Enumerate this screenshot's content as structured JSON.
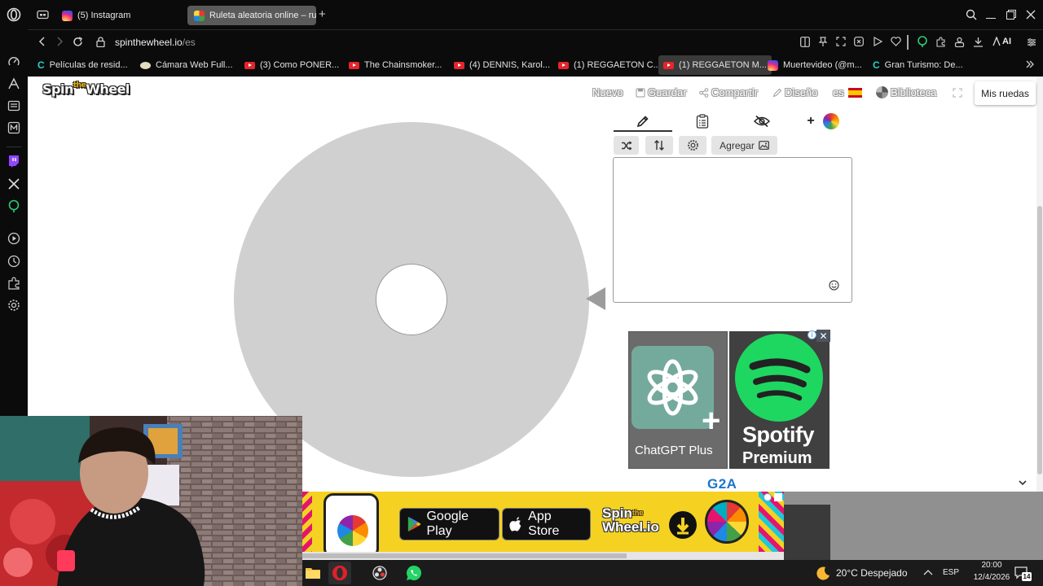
{
  "browser": {
    "tabs": [
      {
        "label": "(5) Instagram",
        "active": false
      },
      {
        "label": "Ruleta aleatoria online – ru",
        "active": true
      }
    ],
    "new_tab_label": "+",
    "url": {
      "domain": "spinthewheel.io",
      "path": "/es"
    },
    "toolbar_ai_label": "AI",
    "bookmarks": [
      {
        "label": "Películas de resid...",
        "icon": "c-icon"
      },
      {
        "label": "Cámara Web Full...",
        "icon": "globe-icon"
      },
      {
        "label": "(3) Como PONER...",
        "icon": "youtube-icon"
      },
      {
        "label": "The Chainsmoker...",
        "icon": "youtube-icon"
      },
      {
        "label": "(4) DENNIS, Karol...",
        "icon": "youtube-icon"
      },
      {
        "label": "(1) REGGAETON C...",
        "icon": "youtube-icon"
      },
      {
        "label": "(1) REGGAETON M...",
        "icon": "youtube-icon"
      },
      {
        "label": "Muertevideo (@m...",
        "icon": "instagram-icon"
      },
      {
        "label": "Gran Turismo: De...",
        "icon": "c-icon"
      }
    ]
  },
  "site": {
    "logo": {
      "spin": "Spin",
      "the": "the",
      "wheel": "Wheel"
    },
    "nav": {
      "nuevo": "Nuevo",
      "guardar": "Guardar",
      "compartir": "Compartir",
      "diseno": "Diseño",
      "lang": "es",
      "biblioteca": "Biblioteca",
      "mis_ruedas": "Mis ruedas"
    },
    "editor": {
      "add_button": "Agregar",
      "plus": "+",
      "entries_value": ""
    }
  },
  "ads": {
    "chatgpt": "ChatGPT Plus",
    "spotify_title": "Spotify",
    "spotify_sub": "Premium",
    "g2a": "G2A",
    "close": "✕",
    "info": "i",
    "banner": {
      "google_play": "Google Play",
      "app_store": "App Store",
      "brand_line1": "Spin",
      "brand_the": "the",
      "brand_line2": "Wheel.io"
    }
  },
  "taskbar": {
    "weather": "20°C  Despejado",
    "lang": "ESP",
    "time": "20:00",
    "date": "12/4/2026",
    "notifications": "14"
  },
  "colors": {
    "wheel": "#d0d0d0",
    "chatgpt_green": "#74aa9c",
    "spotify_green": "#1ed760",
    "banner_yellow": "#f5d221",
    "g2a_blue": "#1a76c9"
  }
}
